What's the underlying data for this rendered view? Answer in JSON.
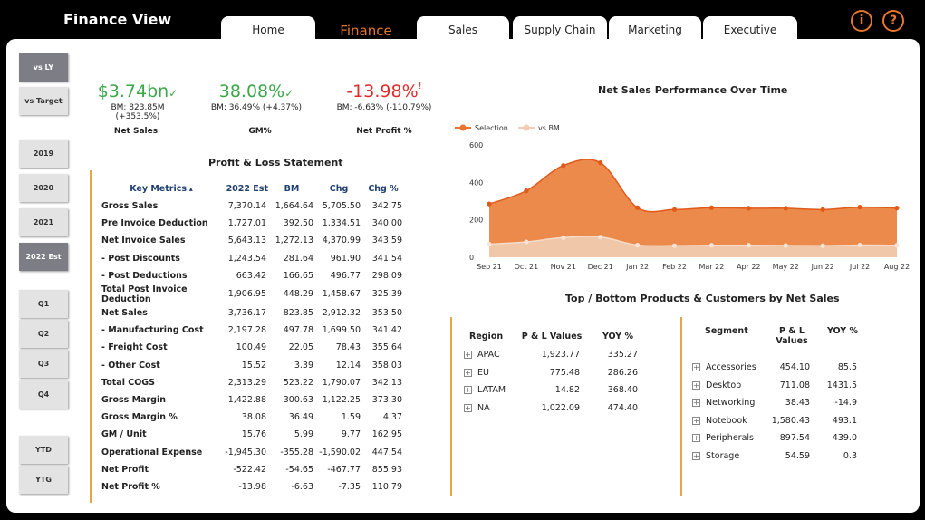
{
  "app": {
    "title": "Finance View"
  },
  "tabs": [
    "Home",
    "Finance",
    "Sales",
    "Supply Chain",
    "Marketing",
    "Executive"
  ],
  "header_icons": {
    "info": "i",
    "help": "?"
  },
  "colors": {
    "accent": "#e8762c",
    "positive": "#3aa84a",
    "negative": "#e02b2b"
  },
  "sidebar": {
    "compare": [
      "vs LY",
      "vs Target"
    ],
    "years": [
      "2019",
      "2020",
      "2021",
      "2022 Est"
    ],
    "quarters": [
      "Q1",
      "Q2",
      "Q3",
      "Q4"
    ],
    "periods": [
      "YTD",
      "YTG"
    ]
  },
  "kpis": [
    {
      "value": "$3.74bn",
      "mark": "✓",
      "sub": "BM: 823.85M (+353.5%)",
      "label": "Net Sales"
    },
    {
      "value": "38.08%",
      "mark": "✓",
      "sub": "BM: 36.49% (+4.37%)",
      "label": "GM%"
    },
    {
      "value": "-13.98%",
      "mark": "!",
      "sub": "BM: -6.63% (-110.79%)",
      "label": "Net Profit %"
    }
  ],
  "pl": {
    "title": "Profit & Loss Statement",
    "headers": [
      "Key Metrics",
      "2022 Est",
      "BM",
      "Chg",
      "Chg %"
    ],
    "rows": [
      [
        "Gross Sales",
        "7,370.14",
        "1,664.64",
        "5,705.50",
        "342.75"
      ],
      [
        "Pre Invoice Deduction",
        "1,727.01",
        "392.50",
        "1,334.51",
        "340.00"
      ],
      [
        "Net Invoice Sales",
        "5,643.13",
        "1,272.13",
        "4,370.99",
        "343.59"
      ],
      [
        "- Post Discounts",
        "1,243.54",
        "281.64",
        "961.90",
        "341.54"
      ],
      [
        "- Post Deductions",
        "663.42",
        "166.65",
        "496.77",
        "298.09"
      ],
      [
        "Total Post Invoice Deduction",
        "1,906.95",
        "448.29",
        "1,458.67",
        "325.39"
      ],
      [
        "Net Sales",
        "3,736.17",
        "823.85",
        "2,912.32",
        "353.50"
      ],
      [
        "- Manufacturing Cost",
        "2,197.28",
        "497.78",
        "1,699.50",
        "341.42"
      ],
      [
        "- Freight Cost",
        "100.49",
        "22.05",
        "78.43",
        "355.64"
      ],
      [
        "- Other Cost",
        "15.52",
        "3.39",
        "12.14",
        "358.03"
      ],
      [
        "Total COGS",
        "2,313.29",
        "523.22",
        "1,790.07",
        "342.13"
      ],
      [
        "Gross Margin",
        "1,422.88",
        "300.63",
        "1,122.25",
        "373.30"
      ],
      [
        "Gross Margin %",
        "38.08",
        "36.49",
        "1.59",
        "4.37"
      ],
      [
        "GM / Unit",
        "15.76",
        "5.99",
        "9.77",
        "162.95"
      ],
      [
        "Operational Expense",
        "-1,945.30",
        "-355.28",
        "-1,590.02",
        "447.54"
      ],
      [
        "Net Profit",
        "-522.42",
        "-54.65",
        "-467.77",
        "855.93"
      ],
      [
        "Net Profit %",
        "-13.98",
        "-6.63",
        "-7.35",
        "110.79"
      ]
    ]
  },
  "chart_data": {
    "type": "area",
    "title": "Net Sales Performance Over Time",
    "x": [
      "Sep 21",
      "Oct 21",
      "Nov 21",
      "Dec 21",
      "Jan 22",
      "Feb 22",
      "Mar 22",
      "Apr 22",
      "May 22",
      "Jun 22",
      "Jul 22",
      "Aug 22"
    ],
    "series": [
      {
        "name": "Selection",
        "color": "#e8762c",
        "values": [
          285,
          355,
          490,
          505,
          265,
          255,
          265,
          262,
          262,
          255,
          268,
          263
        ]
      },
      {
        "name": "vs BM",
        "color": "#f2cdb4",
        "values": [
          70,
          82,
          105,
          108,
          65,
          62,
          64,
          64,
          63,
          62,
          65,
          64
        ]
      }
    ],
    "ylim": [
      0,
      600
    ],
    "yticks": [
      0,
      200,
      400,
      600
    ],
    "legend": "top-left"
  },
  "topbottom": {
    "title": "Top / Bottom Products & Customers by Net Sales",
    "region": {
      "headers": [
        "Region",
        "P & L Values",
        "YOY %"
      ],
      "rows": [
        [
          "APAC",
          "1,923.77",
          "335.27"
        ],
        [
          "EU",
          "775.48",
          "286.26"
        ],
        [
          "LATAM",
          "14.82",
          "368.40"
        ],
        [
          "NA",
          "1,022.09",
          "474.40"
        ]
      ]
    },
    "segment": {
      "headers": [
        "Segment",
        "P & L Values",
        "YOY %"
      ],
      "rows": [
        [
          "Accessories",
          "454.10",
          "85.5"
        ],
        [
          "Desktop",
          "711.08",
          "1431.5"
        ],
        [
          "Networking",
          "38.43",
          "-14.9"
        ],
        [
          "Notebook",
          "1,580.43",
          "493.1"
        ],
        [
          "Peripherals",
          "897.54",
          "439.0"
        ],
        [
          "Storage",
          "54.59",
          "0.3"
        ]
      ]
    }
  }
}
